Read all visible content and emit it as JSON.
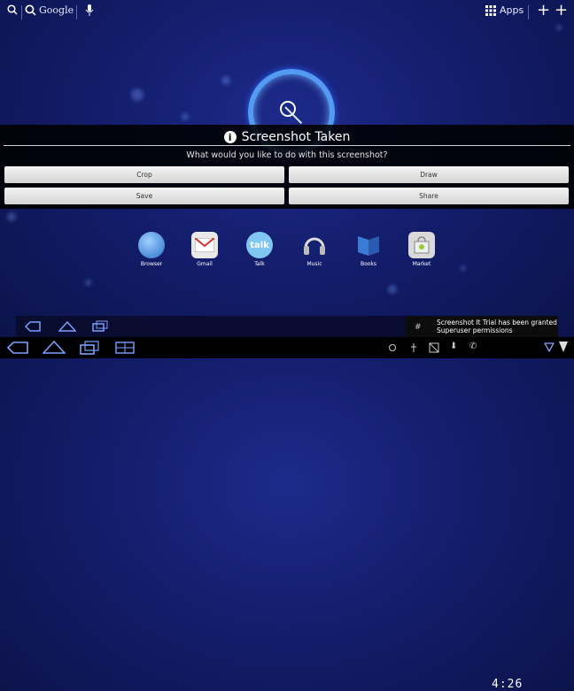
{
  "top_bar": {
    "search_brand": "Google",
    "apps_label": "Apps"
  },
  "dialog": {
    "title": "Screenshot Taken",
    "message": "What would you like to do with this screenshot?",
    "buttons": {
      "crop": "Crop",
      "draw": "Draw",
      "save": "Save",
      "share": "Share"
    }
  },
  "apps": [
    {
      "label": "Browser",
      "icon": "globe-icon"
    },
    {
      "label": "Gmail",
      "icon": "gmail-icon"
    },
    {
      "label": "Talk",
      "icon": "talk-icon"
    },
    {
      "label": "Music",
      "icon": "headphones-icon"
    },
    {
      "label": "Books",
      "icon": "books-icon"
    },
    {
      "label": "Market",
      "icon": "market-bag-icon"
    }
  ],
  "notification": {
    "text": "Screenshot It Trial has been granted Superuser permissions"
  },
  "status": {
    "time": "4:26"
  },
  "colors": {
    "accent": "#5aa8ff",
    "background": "#131d6b"
  }
}
